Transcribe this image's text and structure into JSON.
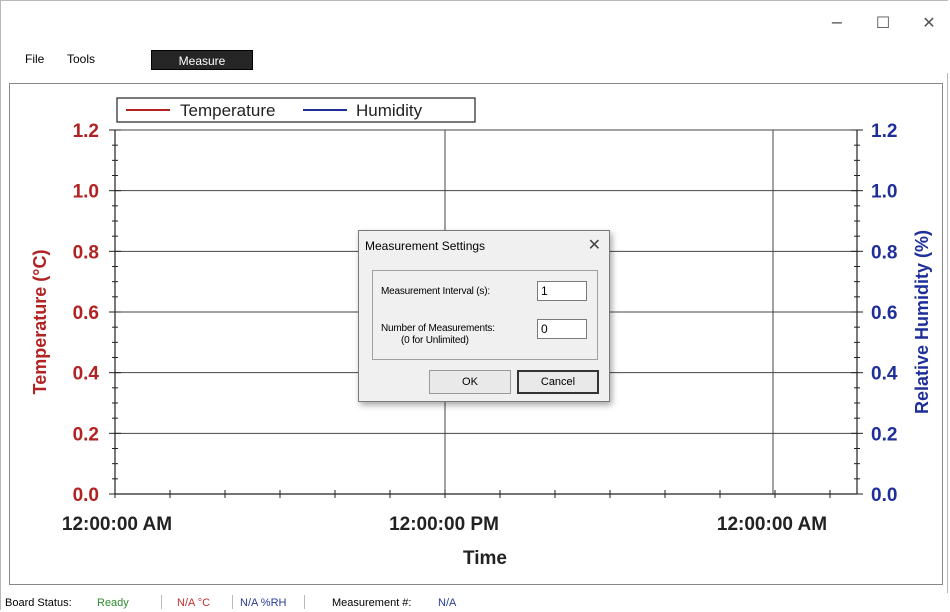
{
  "window": {
    "controls": {
      "minimize": "−",
      "maximize": "☐",
      "close": "✕"
    }
  },
  "menu": {
    "file": "File",
    "tools": "Tools",
    "measure": "Measure"
  },
  "chart_data": {
    "type": "line",
    "legend": [
      "Temperature",
      "Humidity"
    ],
    "legend_placement": "top-left",
    "colors": {
      "temperature": "#b22222",
      "humidity": "#1f2f99"
    },
    "xlabel": "Time",
    "x_ticks": [
      "12:00:00 AM",
      "12:00:00 PM",
      "12:00:00 AM"
    ],
    "ylabel_left": "Temperature (°C)",
    "ylabel_right": "Relative Humidity (%)",
    "y_ticks_left": [
      "0.0",
      "0.2",
      "0.4",
      "0.6",
      "0.8",
      "1.0",
      "1.2"
    ],
    "y_ticks_right": [
      "0.0",
      "0.2",
      "0.4",
      "0.6",
      "0.8",
      "1.0",
      "1.2"
    ],
    "ylim": [
      0,
      1.2
    ],
    "grid": true,
    "series": []
  },
  "dialog": {
    "title": "Measurement Settings",
    "close": "✕",
    "interval_label": "Measurement Interval (s):",
    "interval_value": "1",
    "count_label": "Number of Measurements:",
    "count_sublabel": "(0 for Unlimited)",
    "count_value": "0",
    "ok": "OK",
    "cancel": "Cancel"
  },
  "status": {
    "board_label": "Board Status:",
    "board_value": "Ready",
    "board_color": "#2e8b2e",
    "temp": "N/A °C",
    "temp_color": "#c03030",
    "humidity": "N/A %RH",
    "humidity_color": "#2a3a9a",
    "meas_label": "Measurement #:",
    "meas_value": "N/A",
    "meas_color": "#2a3a9a"
  }
}
